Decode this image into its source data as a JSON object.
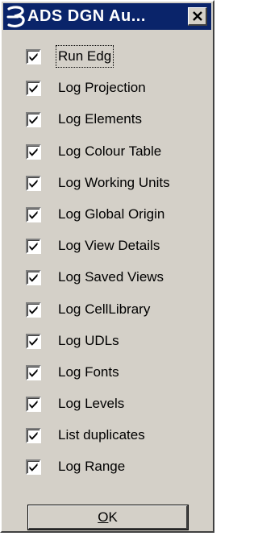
{
  "window": {
    "title": "ADS DGN Au...",
    "title_icon": "bentley-b-icon",
    "close_icon": "close-x-icon"
  },
  "colors": {
    "titlebar_bg": "#0a246a",
    "title_text": "#ffffff",
    "dialog_bg": "#d4d0c8"
  },
  "options": [
    {
      "label": "Run Edg",
      "checked": true,
      "focused": true
    },
    {
      "label": "Log Projection",
      "checked": true,
      "focused": false
    },
    {
      "label": "Log Elements",
      "checked": true,
      "focused": false
    },
    {
      "label": "Log Colour Table",
      "checked": true,
      "focused": false
    },
    {
      "label": "Log Working Units",
      "checked": true,
      "focused": false
    },
    {
      "label": "Log Global Origin",
      "checked": true,
      "focused": false
    },
    {
      "label": "Log View Details",
      "checked": true,
      "focused": false
    },
    {
      "label": "Log Saved Views",
      "checked": true,
      "focused": false
    },
    {
      "label": "Log CellLibrary",
      "checked": true,
      "focused": false
    },
    {
      "label": "Log UDLs",
      "checked": true,
      "focused": false
    },
    {
      "label": "Log Fonts",
      "checked": true,
      "focused": false
    },
    {
      "label": "Log Levels",
      "checked": true,
      "focused": false
    },
    {
      "label": "List duplicates",
      "checked": true,
      "focused": false
    },
    {
      "label": "Log Range",
      "checked": true,
      "focused": false
    }
  ],
  "ok_button": {
    "label_mnemonic": "O",
    "label_rest": "K"
  }
}
